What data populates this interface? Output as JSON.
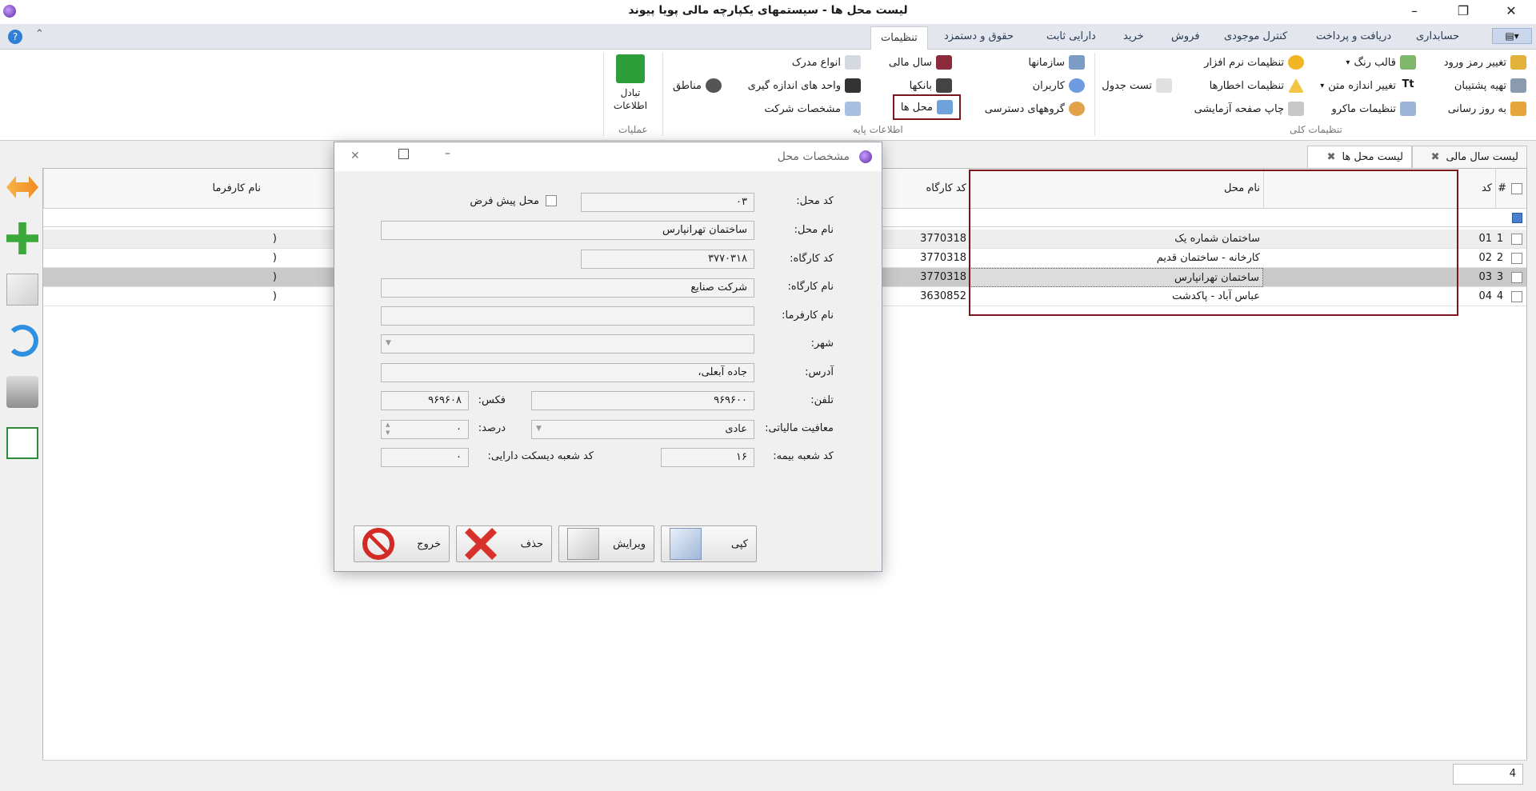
{
  "window": {
    "title": "لیست محل ها - سیستمهای یکپارچه مالی پویا پیوند"
  },
  "menu": {
    "tabs": [
      "حسابداری",
      "دریافت و پرداخت",
      "کنترل موجودی",
      "فروش",
      "خرید",
      "دارایی ثابت",
      "حقوق و دستمزد",
      "تنظیمات"
    ],
    "active": "تنظیمات"
  },
  "ribbon": {
    "general": {
      "label": "تنظیمات کلی",
      "items": [
        "تغییر رمز ورود",
        "تهیه پشتیبان",
        "به روز رسانی",
        "قالب رنگ",
        "تغییر اندازه متن",
        "تنظیمات ماکرو",
        "تنظیمات نرم افزار",
        "تنظیمات اخطارها",
        "چاپ صفحه آزمایشی",
        "تست جدول"
      ]
    },
    "base": {
      "label": "اطلاعات پایه",
      "items": [
        "سازمانها",
        "کاربران",
        "گروههای دسترسی",
        "سال مالی",
        "بانکها",
        "محل ها",
        "انواع مدرک",
        "واحد های اندازه گیری",
        "مشخصات شرکت",
        "مناطق"
      ]
    },
    "ops": {
      "label": "عملیات",
      "exchange": "تبادل اطلاعات"
    }
  },
  "doc_tabs": [
    "لیست سال مالی",
    "لیست محل ها"
  ],
  "grid": {
    "columns": {
      "num": "#",
      "code": "کد",
      "name": "نام محل",
      "workshop_code": "کد کارگاه",
      "employer": "نام کارفرما"
    },
    "rows": [
      {
        "num": "1",
        "code": "01",
        "name": "ساختمان شماره یک",
        "workshop_code": "3770318",
        "employer": "("
      },
      {
        "num": "2",
        "code": "02",
        "name": "کارخانه - ساختمان قدیم",
        "workshop_code": "3770318",
        "employer": "("
      },
      {
        "num": "3",
        "code": "03",
        "name": "ساختمان تهرانپارس",
        "workshop_code": "3770318",
        "employer": "("
      },
      {
        "num": "4",
        "code": "04",
        "name": "عباس آباد - پاکدشت",
        "workshop_code": "3630852",
        "employer": "("
      }
    ],
    "record_count": "4"
  },
  "dialog": {
    "title": "مشخصات محل",
    "fields": {
      "code": {
        "label": "کد محل:",
        "value": "۰۳"
      },
      "default": {
        "label": "محل پیش فرض"
      },
      "name": {
        "label": "نام محل:",
        "value": "ساختمان تهرانپارس"
      },
      "workshop_code": {
        "label": "کد کارگاه:",
        "value": "۳۷۷۰۳۱۸"
      },
      "workshop_name": {
        "label": "نام کارگاه:",
        "value": "شرکت صنایع"
      },
      "employer": {
        "label": "نام کارفرما:",
        "value": ""
      },
      "city": {
        "label": "شهر:",
        "value": ""
      },
      "address": {
        "label": "آدرس:",
        "value": "جاده آبعلی،"
      },
      "phone": {
        "label": "تلفن:",
        "value": "۹۶۹۶۰۰"
      },
      "fax": {
        "label": "فکس:",
        "value": "۹۶۹۶۰۸"
      },
      "tax": {
        "label": "معافیت مالیاتی:",
        "value": "عادی"
      },
      "percent": {
        "label": "درصد:",
        "value": "۰"
      },
      "insurance": {
        "label": "کد شعبه بیمه:",
        "value": "۱۶"
      },
      "finance": {
        "label": "کد شعبه دیسکت دارایی:",
        "value": "۰"
      }
    },
    "buttons": {
      "copy": "کپی",
      "edit": "ویرایش",
      "delete": "حذف",
      "exit": "خروج"
    }
  }
}
